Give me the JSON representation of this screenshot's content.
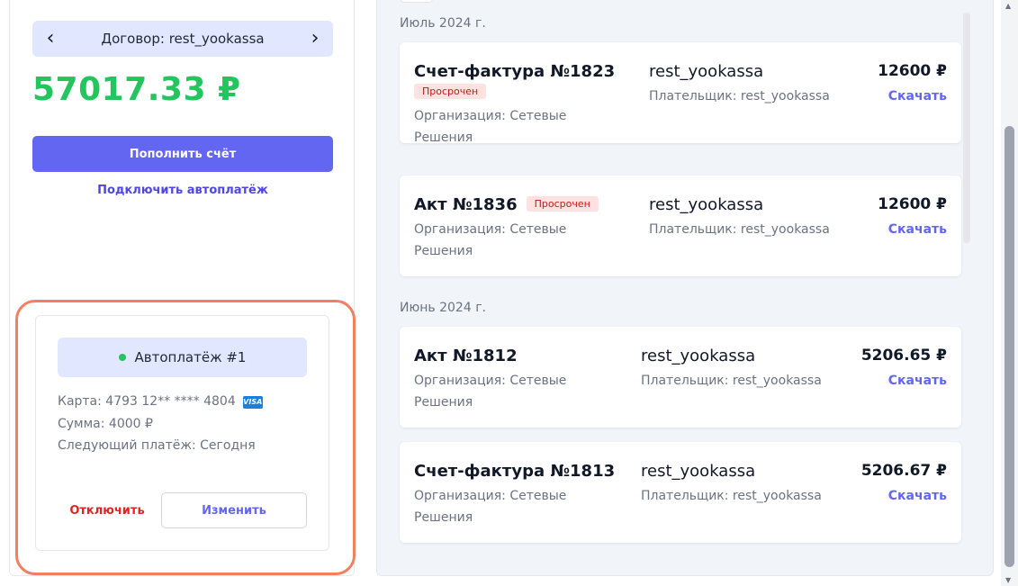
{
  "left": {
    "contract_label": "Договор: rest_yookassa",
    "prev_arrow": "‹",
    "next_arrow": "›",
    "balance": "57017.33 ₽",
    "balance_color": "#22c55e",
    "topup_button": "Пополнить счёт",
    "autopay_link": "Подключить автоплатёж",
    "autopay": {
      "title": "Автоплатёж #1",
      "status_color": "#22c55e",
      "card_line": "Карта: 4793 12** **** 4804",
      "card_brand": "VISA",
      "amount_line": "Сумма: 4000 ₽",
      "next_line": "Следующий платёж: Сегодня",
      "disable_button": "Отключить",
      "change_button": "Изменить"
    }
  },
  "documents": {
    "groups": [
      {
        "month": "Июль 2024 г.",
        "items": [
          {
            "title": "Счет-фактура №1823",
            "badge": "Просрочен",
            "org": "Организация: Сетевые Решения",
            "contract": "rest_yookassa",
            "payer": "Плательщик: rest_yookassa",
            "amount": "12600 ₽",
            "download": "Скачать"
          },
          {
            "title": "Акт №1836",
            "badge": "Просрочен",
            "org": "Организация: Сетевые Решения",
            "contract": "rest_yookassa",
            "payer": "Плательщик: rest_yookassa",
            "amount": "12600 ₽",
            "download": "Скачать"
          }
        ]
      },
      {
        "month": "Июнь 2024 г.",
        "items": [
          {
            "title": "Акт №1812",
            "org": "Организация: Сетевые Решения",
            "contract": "rest_yookassa",
            "payer": "Плательщик: rest_yookassa",
            "amount": "5206.65 ₽",
            "download": "Скачать"
          },
          {
            "title": "Счет-фактура №1813",
            "org": "Организация: Сетевые Решения",
            "contract": "rest_yookassa",
            "payer": "Плательщик: rest_yookassa",
            "amount": "5206.67 ₽",
            "download": "Скачать"
          }
        ]
      }
    ]
  },
  "colors": {
    "accent": "#6366f1",
    "danger": "#dc2626",
    "highlight": "#f08060"
  }
}
